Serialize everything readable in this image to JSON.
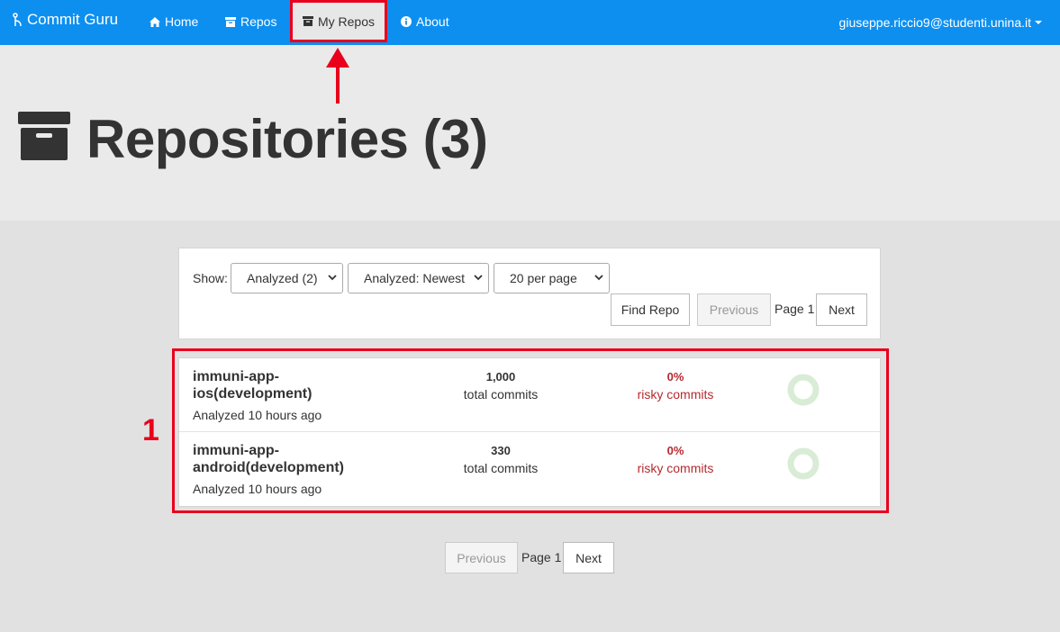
{
  "navbar": {
    "brand": "Commit Guru",
    "items": [
      {
        "label": "Home",
        "icon": "home-icon"
      },
      {
        "label": "Repos",
        "icon": "archive-icon"
      },
      {
        "label": "My Repos",
        "icon": "archive-icon",
        "active": true
      },
      {
        "label": "About",
        "icon": "info-icon"
      }
    ],
    "user": "giuseppe.riccio9@studenti.unina.it"
  },
  "page": {
    "title": "Repositories (3)",
    "title_icon": "archive-icon"
  },
  "filters": {
    "show_label": "Show:",
    "status_select": "Analyzed (2)",
    "sort_select": "Analyzed: Newest",
    "per_page_select": "20 per page",
    "find_button": "Find Repo",
    "previous": "Previous",
    "page": "Page 1",
    "next": "Next"
  },
  "repos": [
    {
      "name": "immuni-app-ios(development)",
      "analyzed": "Analyzed 10 hours ago",
      "commits": "1,000",
      "commits_label": "total commits",
      "risky": "0%",
      "risky_label": "risky commits"
    },
    {
      "name": "immuni-app-android(development)",
      "analyzed": "Analyzed 10 hours ago",
      "commits": "330",
      "commits_label": "total commits",
      "risky": "0%",
      "risky_label": "risky commits"
    }
  ],
  "bottom_pager": {
    "previous": "Previous",
    "page": "Page 1",
    "next": "Next"
  },
  "annotation": {
    "label": "1"
  },
  "colors": {
    "navbar": "#0d8ff0",
    "highlight": "#e8001c",
    "risk": "#b52a2f",
    "donut": "#d9ecd6"
  }
}
